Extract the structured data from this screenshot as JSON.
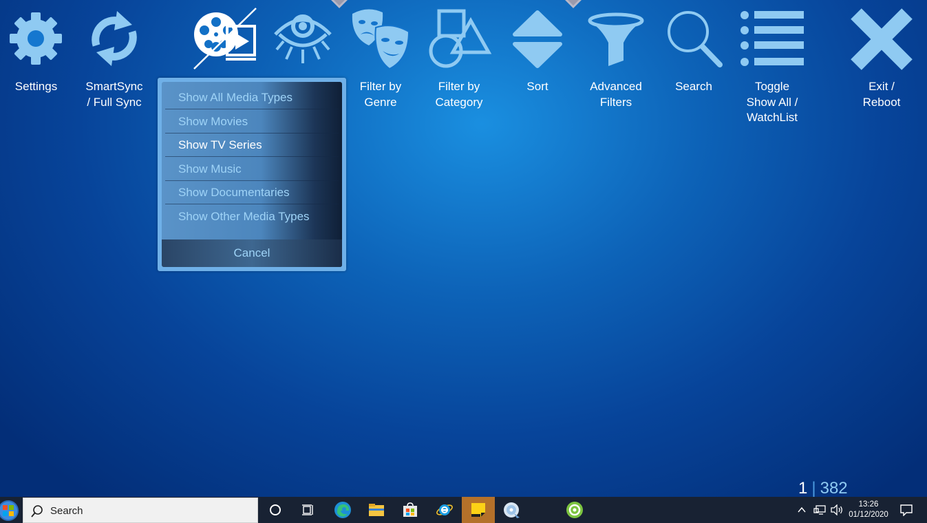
{
  "toolbar": {
    "settings": "Settings",
    "smartsync": "SmartSync\n/ Full Sync",
    "filter_genre": "Filter by\nGenre",
    "filter_category": "Filter by\nCategory",
    "sort": "Sort",
    "advanced_filters": "Advanced\nFilters",
    "search": "Search",
    "toggle_watchlist": "Toggle\nShow All /\nWatchList",
    "exit_reboot": "Exit /\nReboot"
  },
  "media_menu": {
    "items": [
      "Show All Media Types",
      "Show Movies",
      "Show TV Series",
      "Show Music",
      "Show Documentaries",
      "Show Other Media Types"
    ],
    "selected": "Show TV Series",
    "cancel": "Cancel"
  },
  "pager": {
    "current": "1",
    "separator": "|",
    "total": "382"
  },
  "taskbar": {
    "search_placeholder": "Search",
    "time": "13:26",
    "date": "01/12/2020"
  },
  "colors": {
    "icon": "#8fcaf2",
    "label": "#ffffff",
    "menu_text": "#9ed3f7",
    "accent": "#4d9ce0"
  }
}
